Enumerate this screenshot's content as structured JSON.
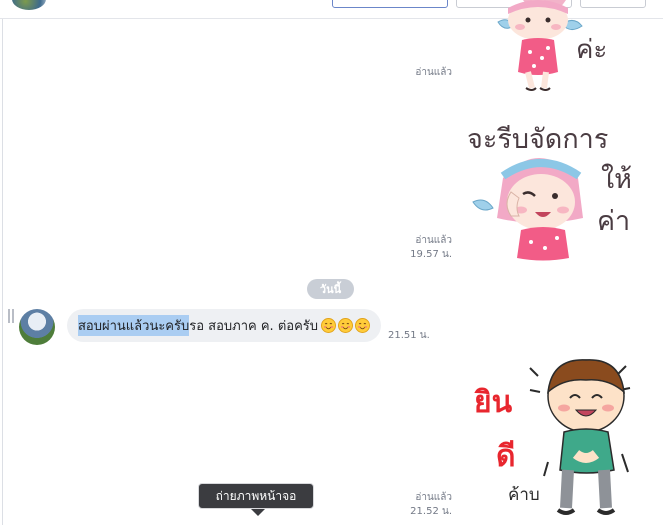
{
  "header": {
    "avatar_icon": "profile-photo-icon"
  },
  "messages": {
    "read_label_1": "อ่านแล้ว",
    "read_label_2": "อ่านแล้ว",
    "time_2": "19.57 น.",
    "day_divider": "วันนี้",
    "incoming": {
      "text_highlighted": "สอบผ่านแล้วนะครับ",
      "text_rest": "รอ สอบภาค ค. ต่อครับ",
      "emojis": [
        "smiling-face-icon",
        "smiling-face-icon",
        "smiling-face-icon"
      ],
      "time": "21.51 น."
    },
    "read_label_3": "อ่านแล้ว",
    "time_3": "21.52 น."
  },
  "stickers": {
    "sticker1_text": "ค่ะ",
    "sticker2_text_line1": "จะรีบจัดการ",
    "sticker2_text_line2": "ให้",
    "sticker2_text_line3": "ค่า",
    "sticker3_text_line1": "ยิน",
    "sticker3_text_line2": "ดี",
    "sticker3_text_line3": "ค้าบ"
  },
  "tooltip": {
    "label": "ถ่ายภาพหน้าจอ"
  },
  "colors": {
    "highlight": "#aacdf2",
    "bubble": "#eef0f3",
    "pill": "#c9ced6",
    "tooltip_bg": "#3b3c40"
  }
}
